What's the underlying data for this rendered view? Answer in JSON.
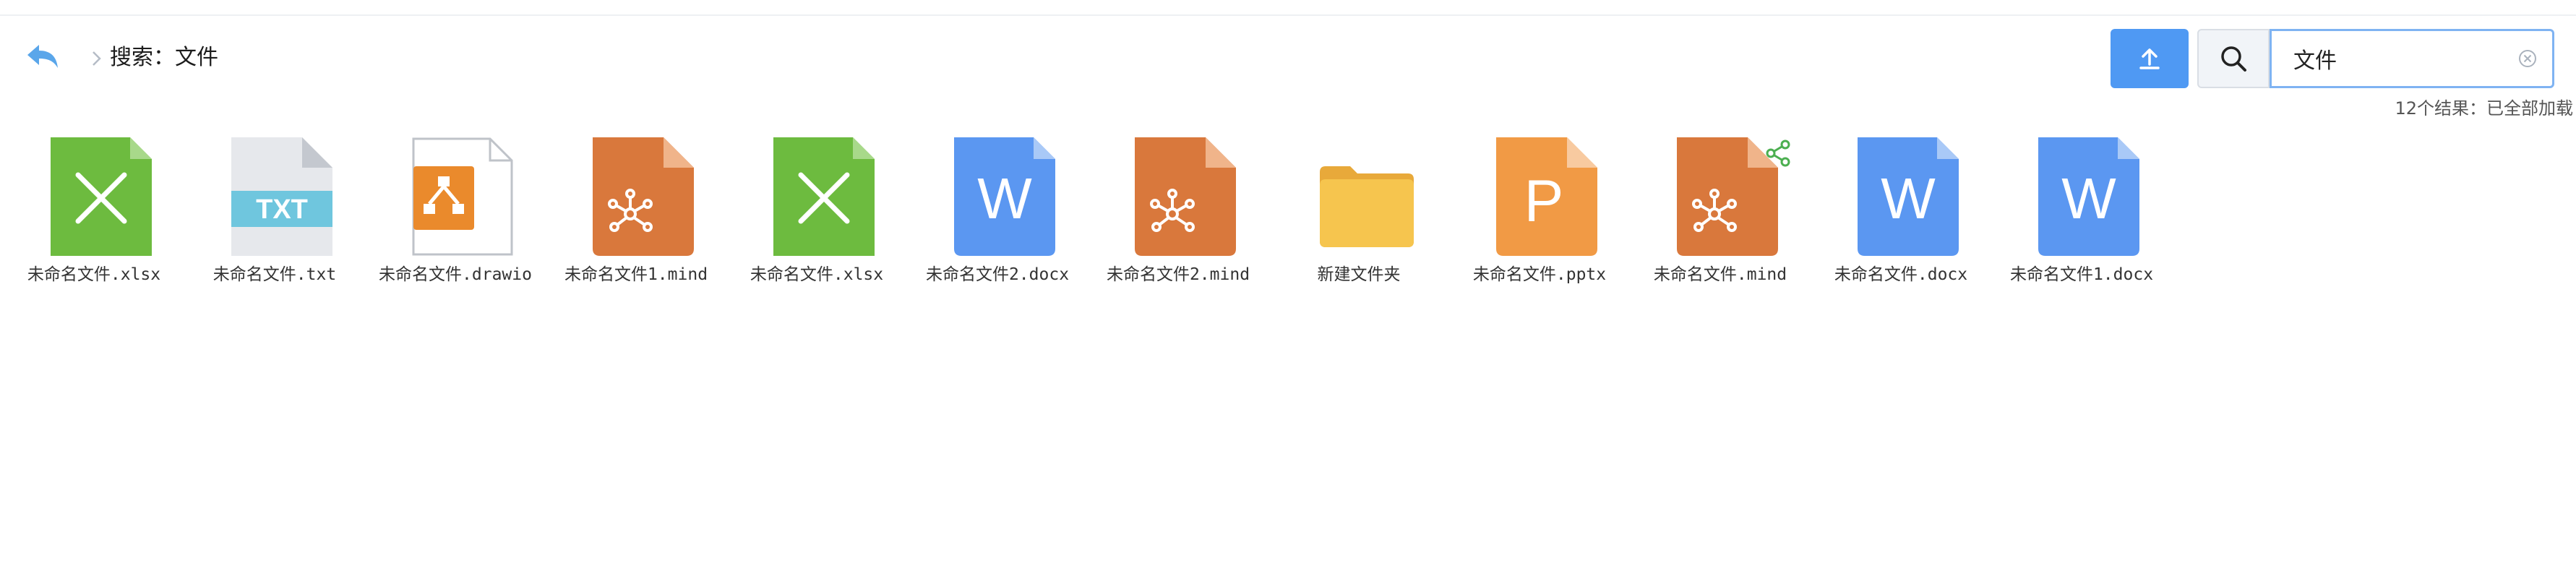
{
  "header": {
    "search_title": "搜索：文件",
    "back_icon": "undo-arrow-icon",
    "separator_icon": "chevron-right-icon"
  },
  "toolbar": {
    "upload_icon": "upload-icon",
    "search_icon": "search-icon",
    "search_value": "文件",
    "clear_icon": "clear-circle-icon"
  },
  "results": {
    "summary": "12个结果：已全部加载"
  },
  "files": [
    {
      "name": "未命名文件.xlsx",
      "type": "xlsx",
      "icon": "excel-file-icon"
    },
    {
      "name": "未命名文件.txt",
      "type": "txt",
      "icon": "txt-file-icon",
      "label": "TXT"
    },
    {
      "name": "未命名文件.drawio",
      "type": "drawio",
      "icon": "drawio-file-icon"
    },
    {
      "name": "未命名文件1.mind",
      "type": "mind",
      "icon": "mindmap-file-icon"
    },
    {
      "name": "未命名文件.xlsx",
      "type": "xlsx",
      "icon": "excel-file-icon"
    },
    {
      "name": "未命名文件2.docx",
      "type": "docx",
      "icon": "word-file-icon",
      "label": "W"
    },
    {
      "name": "未命名文件2.mind",
      "type": "mind",
      "icon": "mindmap-file-icon"
    },
    {
      "name": "新建文件夹",
      "type": "folder",
      "icon": "folder-icon"
    },
    {
      "name": "未命名文件.pptx",
      "type": "pptx",
      "icon": "powerpoint-file-icon",
      "label": "P"
    },
    {
      "name": "未命名文件.mind",
      "type": "mind",
      "icon": "mindmap-file-icon",
      "shared": true,
      "share_icon": "share-icon"
    },
    {
      "name": "未命名文件.docx",
      "type": "docx",
      "icon": "word-file-icon",
      "label": "W"
    },
    {
      "name": "未命名文件1.docx",
      "type": "docx",
      "icon": "word-file-icon",
      "label": "W"
    }
  ],
  "colors": {
    "excel": "#6dbb3f",
    "word": "#5b97f1",
    "mind": "#d9783c",
    "ppt": "#f19a45",
    "folder": "#f6c54e",
    "drawio": "#ea8a2c",
    "txt_band": "#6fc6de",
    "accent": "#4f99f3",
    "share": "#4caf50"
  }
}
